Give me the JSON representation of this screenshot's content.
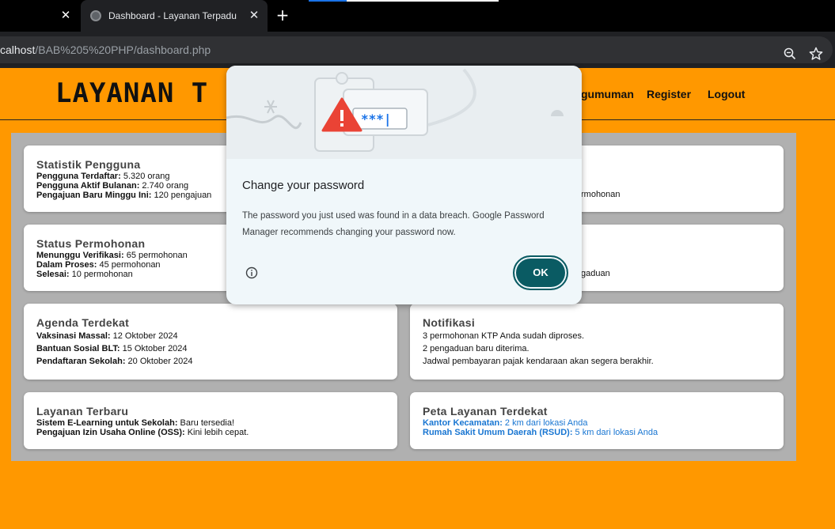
{
  "browser": {
    "active_tab_title": "Dashboard - Layanan Terpadu",
    "url_host": "calhost",
    "url_path": "/BAB%205%20PHP/dashboard.php",
    "icons": [
      "close-icon",
      "globe-icon",
      "plus-icon",
      "zoom-icon",
      "star-icon"
    ]
  },
  "header": {
    "title_visible": "LAYANAN T",
    "nav": {
      "pengumuman": "gumuman",
      "register": "Register",
      "logout": "Logout"
    }
  },
  "cards": {
    "statistik": {
      "title": "Statistik Pengguna",
      "lines": [
        {
          "label": "Pengguna Terdaftar:",
          "value": " 5.320 orang"
        },
        {
          "label": "Pengguna Aktif Bulanan:",
          "value": " 2.740 orang"
        },
        {
          "label": "Pengajuan Baru Minggu Ini:",
          "value": " 120 pengajuan"
        }
      ]
    },
    "top_right_partial": {
      "fragment": "rmohonan"
    },
    "status": {
      "title": "Status Permohonan",
      "lines": [
        {
          "label": "Menunggu Verifikasi:",
          "value": " 65 permohonan"
        },
        {
          "label": "Dalam Proses:",
          "value": " 45 permohonan"
        },
        {
          "label": "Selesai:",
          "value": " 10 permohonan"
        }
      ]
    },
    "mid_right_partial": {
      "fragment": "gaduan"
    },
    "agenda": {
      "title": "Agenda Terdekat",
      "lines": [
        {
          "label": "Vaksinasi Massal:",
          "value": " 12 Oktober 2024"
        },
        {
          "label": "Bantuan Sosial BLT:",
          "value": " 15 Oktober 2024"
        },
        {
          "label": "Pendaftaran Sekolah:",
          "value": " 20 Oktober 2024"
        }
      ]
    },
    "notifikasi": {
      "title": "Notifikasi",
      "lines": [
        "3 permohonan KTP Anda sudah diproses.",
        "2 pengaduan baru diterima.",
        "Jadwal pembayaran pajak kendaraan akan segera berakhir."
      ]
    },
    "layanan": {
      "title": "Layanan Terbaru",
      "lines": [
        {
          "label": "Sistem E-Learning untuk Sekolah:",
          "value": " Baru tersedia!"
        },
        {
          "label": "Pengajuan Izin Usaha Online (OSS):",
          "value": " Kini lebih cepat."
        }
      ]
    },
    "peta": {
      "title": "Peta Layanan Terdekat",
      "lines": [
        {
          "label": "Kantor Kecamatan:",
          "value": " 2 km dari lokasi Anda"
        },
        {
          "label": "Rumah Sakit Umum Daerah (RSUD):",
          "value": " 5 km dari lokasi Anda"
        }
      ]
    }
  },
  "dialog": {
    "title": "Change your password",
    "body": "The password you just used was found in a data breach. Google Password Manager recommends changing your password now.",
    "ok_label": "OK",
    "illustration_text": "***|"
  },
  "colors": {
    "page_bg": "#ff9800",
    "panel_bg": "#b0b0b0",
    "link": "#1976d2",
    "ok_button": "#0a5b63",
    "warning": "#ea4335"
  }
}
